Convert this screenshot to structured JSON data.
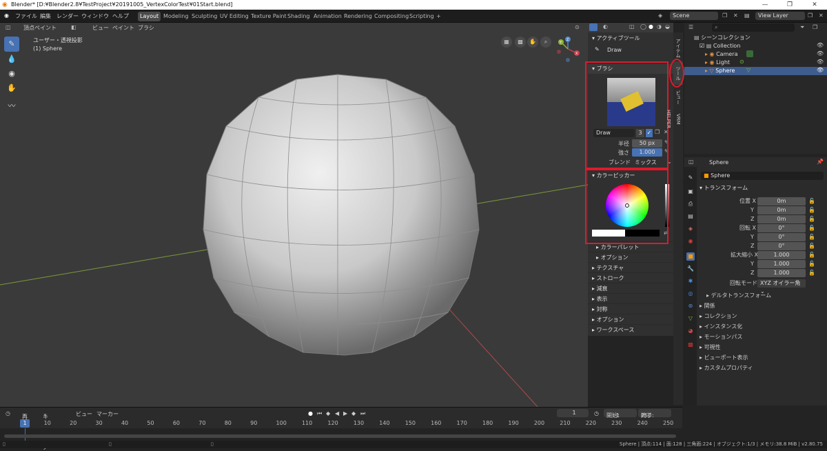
{
  "title": "Blender* [D:¥Blender2.8¥TestProject¥20191005_VertexColorTest¥01Start.blend]",
  "window_controls": [
    "—",
    "❐",
    "✕"
  ],
  "menu": [
    "ファイル",
    "編集",
    "レンダー",
    "ウィンドウ",
    "ヘルプ"
  ],
  "workspaces": [
    "Layout",
    "Modeling",
    "Sculpting",
    "UV Editing",
    "Texture Paint",
    "Shading",
    "Animation",
    "Rendering",
    "Compositing",
    "Scripting"
  ],
  "add_workspace": "+",
  "scene": "Scene",
  "view_layer": "View Layer",
  "viewport": {
    "mode": "頂点ペイント",
    "header_menus": [
      "ビュー",
      "ペイント",
      "ブラシ"
    ],
    "view_name": "ユーザー・透視投影",
    "object_label": "(1) Sphere",
    "gizmo": {
      "x": "X",
      "y": "Y",
      "z": "Z"
    }
  },
  "npanel": {
    "active_tool_header": "アクティブツール",
    "active_tool": "Draw",
    "brush_header": "ブラシ",
    "brush_name": "Draw",
    "brush_users": "3",
    "radius_label": "半径",
    "radius_value": "50 px",
    "strength_label": "強さ",
    "strength_value": "1.000",
    "strength_fill": 1.0,
    "blend_label": "ブレンド",
    "blend_value": "ミックス",
    "color_picker_header": "カラーピッカー",
    "sections": [
      "カラーパレット",
      "オプション",
      "テクスチャ",
      "ストローク",
      "減衰",
      "表示",
      "対称",
      "オプション",
      "ワークスペース"
    ]
  },
  "side_tabs": [
    "アイテム",
    "ツール",
    "ビュー",
    "VRM HELPER"
  ],
  "outliner": {
    "root": "シーンコレクション",
    "collection": "Collection",
    "items": [
      "Camera",
      "Light",
      "Sphere"
    ]
  },
  "properties": {
    "object_name": "Sphere",
    "transform_header": "トランスフォーム",
    "location_label": "位置 X",
    "rotation_label": "回転 X",
    "scale_label": "拡大縮小 X",
    "axis_y": "Y",
    "axis_z": "Z",
    "location": [
      "0m",
      "0m",
      "0m"
    ],
    "rotation": [
      "0°",
      "0°",
      "0°"
    ],
    "scale": [
      "1.000",
      "1.000",
      "1.000"
    ],
    "rotation_mode_label": "回転モード",
    "rotation_mode": "XYZ オイラー角",
    "delta": "デルタトランスフォーム",
    "sections": [
      "関係",
      "コレクション",
      "インスタンス化",
      "モーションパス",
      "可視性",
      "ビューポート表示",
      "カスタムプロパティ"
    ]
  },
  "timeline": {
    "menus": [
      "再生",
      "キーイング",
      "ビュー",
      "マーカー"
    ],
    "current_frame": "1",
    "start_label": "開始:",
    "start": "1",
    "end_label": "終了:",
    "end": "250",
    "ticks": [
      "1",
      "10",
      "20",
      "30",
      "40",
      "50",
      "60",
      "70",
      "80",
      "90",
      "100",
      "110",
      "120",
      "130",
      "140",
      "150",
      "160",
      "170",
      "180",
      "190",
      "200",
      "210",
      "220",
      "230",
      "240",
      "250"
    ]
  },
  "status": "Sphere | 頂点:114 | 面:128 | 三角面:224 | オブジェクト:1/3 | メモリ:38.8 MiB | v2.80.75",
  "colors": {
    "accent": "#4772b3",
    "highlight": "#e0192b",
    "header_bg": "#303030"
  }
}
